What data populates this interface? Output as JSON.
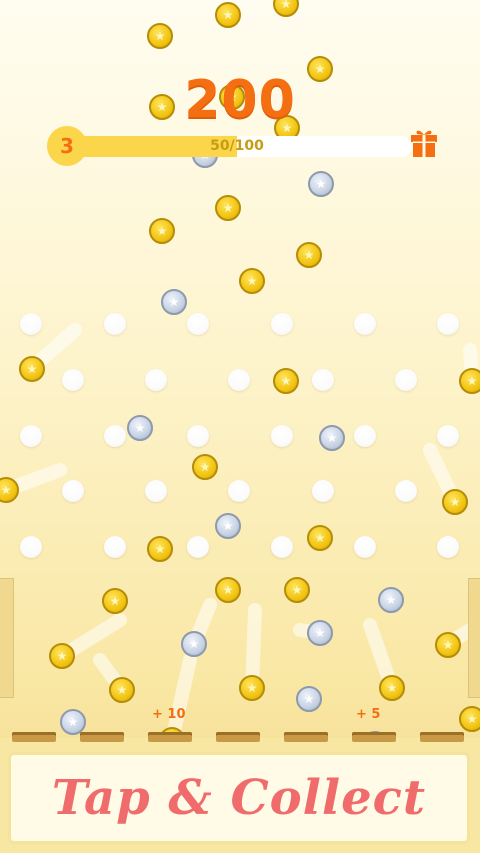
{
  "hud": {
    "score": "200",
    "level": "3",
    "progress_text": "50/100",
    "progress_value": 0.5,
    "reward_icon": "gift-icon"
  },
  "board": {
    "slot_labels": [
      "+ 10",
      "+ 5"
    ]
  },
  "cta": {
    "label": "Tap & Collect"
  },
  "colors": {
    "score": "#f46e12",
    "progress_fill": "#fbd64b",
    "cta_text": "#f06b6b",
    "coin_gold": "#f2c413",
    "coin_silver": "#c7d2e3"
  }
}
